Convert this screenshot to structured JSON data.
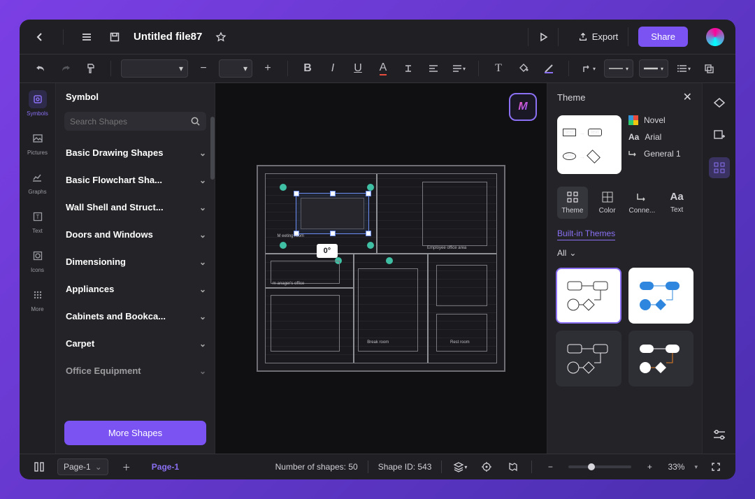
{
  "titlebar": {
    "filename": "Untitled file87",
    "export_label": "Export",
    "share_label": "Share"
  },
  "toolbar": {
    "font_select": "",
    "size_select": ""
  },
  "left_rail": {
    "items": [
      {
        "label": "Symbols"
      },
      {
        "label": "Pictures"
      },
      {
        "label": "Graphs"
      },
      {
        "label": "Text"
      },
      {
        "label": "Icons"
      },
      {
        "label": "More"
      }
    ]
  },
  "symbol_panel": {
    "title": "Symbol",
    "search_placeholder": "Search Shapes",
    "categories": [
      "Basic Drawing Shapes",
      "Basic Flowchart Sha...",
      "Wall Shell and Struct...",
      "Doors and Windows",
      "Dimensioning",
      "Appliances",
      "Cabinets and Bookca...",
      "Carpet",
      "Office Equipment"
    ],
    "more_shapes_label": "More Shapes"
  },
  "canvas": {
    "angle_label": "0°",
    "room_labels": [
      "M eeting room",
      "m anager's office",
      "Employee office area",
      "Break room",
      "Rest room"
    ]
  },
  "theme_panel": {
    "title": "Theme",
    "current_theme": "Novel",
    "current_font": "Arial",
    "current_connector": "General 1",
    "tabs": [
      {
        "label": "Theme"
      },
      {
        "label": "Color"
      },
      {
        "label": "Conne..."
      },
      {
        "label": "Text"
      }
    ],
    "section_link": "Built-in Themes",
    "filter_label": "All"
  },
  "statusbar": {
    "page_selector": "Page-1",
    "page_tab": "Page-1",
    "shape_count_label": "Number of shapes: 50",
    "shape_id_label": "Shape ID: 543",
    "zoom_label": "33%"
  }
}
